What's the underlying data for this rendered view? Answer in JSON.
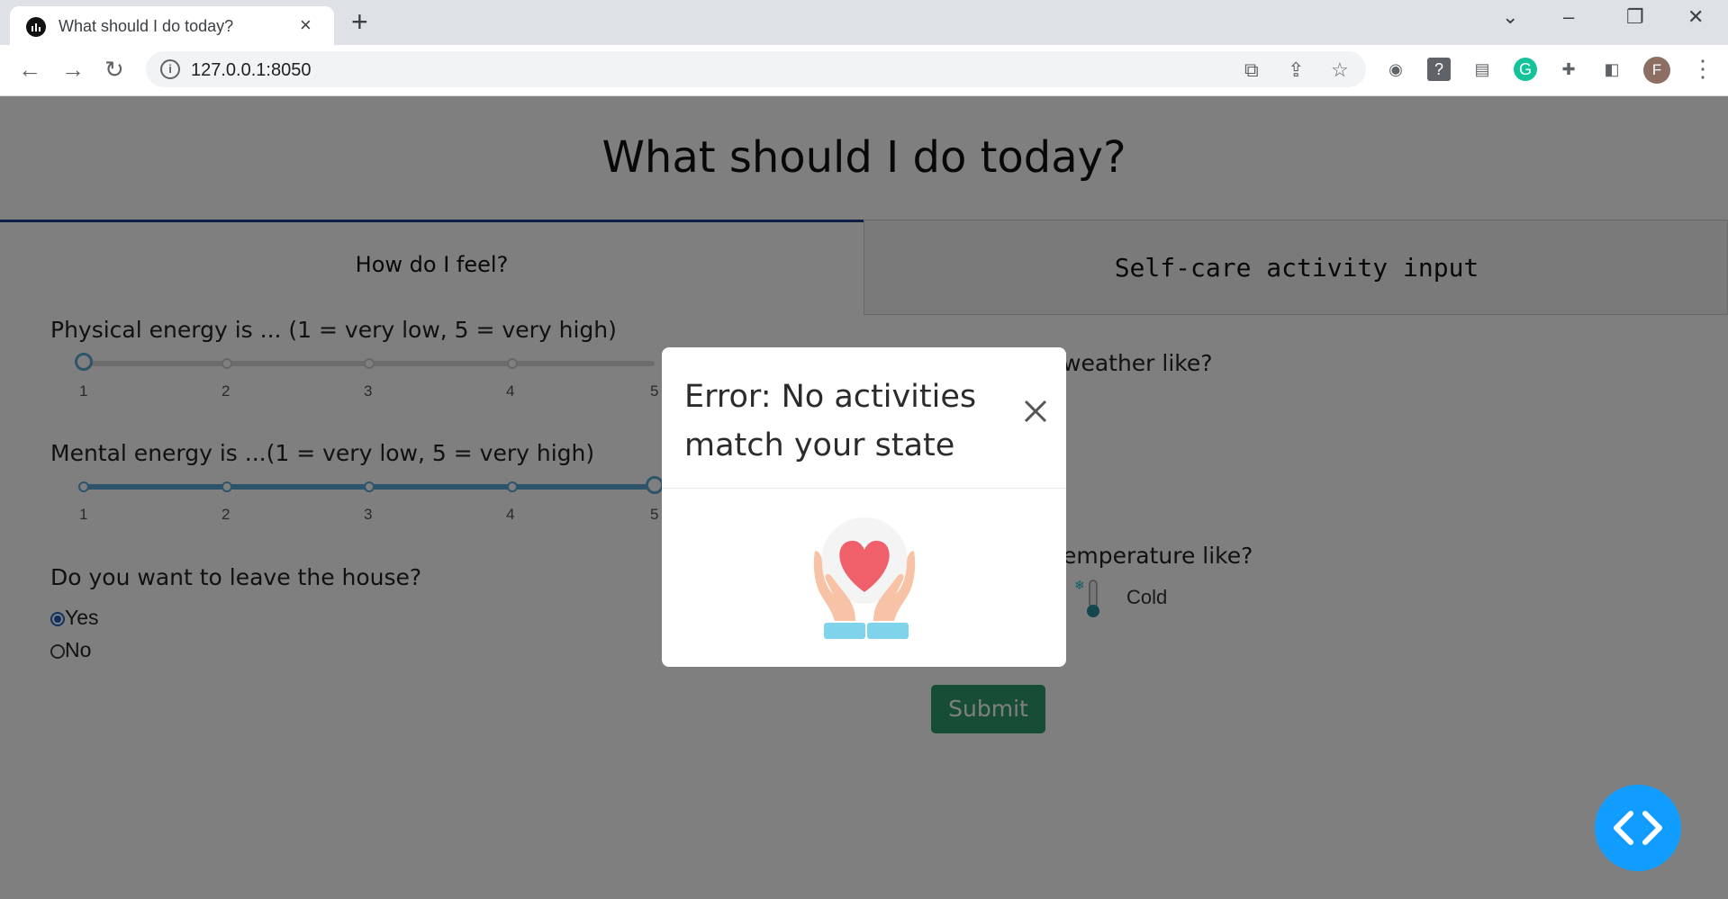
{
  "browser": {
    "tab_title": "What should I do today?",
    "tab_close": "×",
    "new_tab": "+",
    "url": "127.0.0.1:8050",
    "profile_initial": "F",
    "window_controls": [
      "minimize",
      "restore",
      "close"
    ]
  },
  "page": {
    "title": "What should I do today?",
    "tabs": [
      {
        "label": "How do I feel?",
        "active": true
      },
      {
        "label": "Self-care activity input",
        "active": false
      }
    ],
    "physical": {
      "question": "Physical energy is ... (1 = very low, 5 = very high)",
      "ticks": [
        "1",
        "2",
        "3",
        "4",
        "5"
      ],
      "value": 1
    },
    "mental": {
      "question": "Mental energy is ...(1 = very low, 5 = very high)",
      "ticks": [
        "1",
        "2",
        "3",
        "4",
        "5"
      ],
      "value": 5
    },
    "leave_house": {
      "question": "Do you want to leave the house?",
      "options": [
        {
          "label": "Yes",
          "selected": true
        },
        {
          "label": "No",
          "selected": false
        }
      ]
    },
    "weather_question_partial": "weather like?",
    "temperature_question_partial": "emperature like?",
    "temperature_option": "Cold",
    "submit_label": "Submit"
  },
  "modal": {
    "title": "Error: No activities match your state",
    "image": "hands-holding-heart-icon"
  },
  "colors": {
    "accent": "#1f63c3",
    "slider": "#5da9d6",
    "submit": "#2e9b6b",
    "fab": "#119dff",
    "tab_underline": "#1a3d8f"
  }
}
